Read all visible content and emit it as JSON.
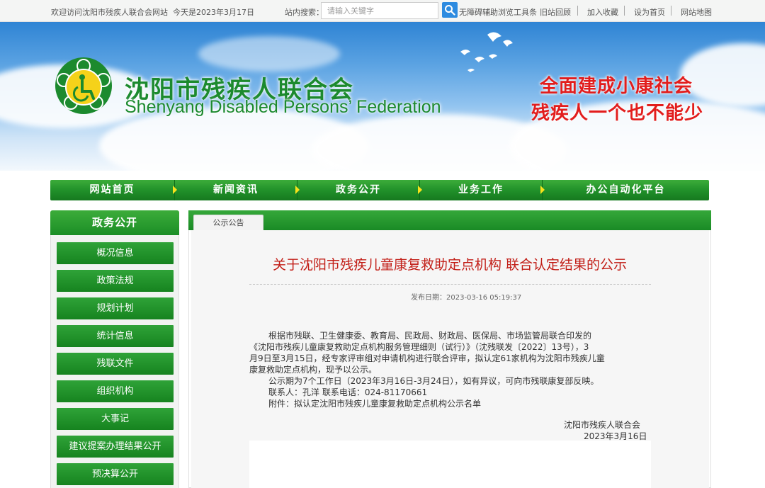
{
  "topbar": {
    "welcome": "欢迎访问沈阳市残疾人联合会网站",
    "today": "今天是2023年3月17日",
    "search_label": "站内搜索：",
    "search_placeholder": "请输入关键字",
    "links": [
      "无障碍辅助浏览工具条",
      "旧站回顾",
      "加入收藏",
      "设为首页",
      "网站地图"
    ]
  },
  "banner": {
    "org_name_cn": "沈阳市残疾人联合会",
    "org_name_en": "Shenyang Disabled Persons’  Federation",
    "slogan_line1": "全面建成小康社会",
    "slogan_line2": "残疾人一个也不能少"
  },
  "nav": {
    "items": [
      "网站首页",
      "新闻资讯",
      "政务公开",
      "业务工作",
      "办公自动化平台"
    ]
  },
  "sidebar": {
    "title": "政务公开",
    "items": [
      "概况信息",
      "政策法规",
      "规划计划",
      "统计信息",
      "残联文件",
      "组织机构",
      "大事记",
      "建议提案办理结果公开",
      "预决算公开"
    ]
  },
  "content": {
    "tab_label": "公示公告",
    "title": "关于沈阳市残疾儿童康复救助定点机构 联合认定结果的公示",
    "publish_date": "发布日期：2023-03-16 05:19:37",
    "body_lines": [
      "根据市残联、卫生健康委、教育局、民政局、财政局、医保局、市场监管局联合印发的",
      "《沈阳市残疾儿童康复救助定点机构服务管理细则（试行）》（沈残联发〔2022〕13号），3",
      "月9日至3月15日，经专家评审组对申请机构进行联合评审，拟认定61家机构为沈阳市残疾儿童",
      "康复救助定点机构，现予以公示。",
      "公示期为7个工作日（2023年3月16日-3月24日），如有异议，可向市残联康复部反映。",
      "联系人：孔洋       联系电话：024-81170661",
      "附件：拟认定沈阳市残疾儿童康复救助定点机构公示名单"
    ],
    "signature_org": "沈阳市残疾人联合会",
    "signature_date": "2023年3月16日"
  },
  "colors": {
    "brand_green": "#1c8a2e",
    "title_red": "#c21e17",
    "slogan_red": "#e21d1d",
    "nav_arrow_yellow": "#f7e21b"
  }
}
